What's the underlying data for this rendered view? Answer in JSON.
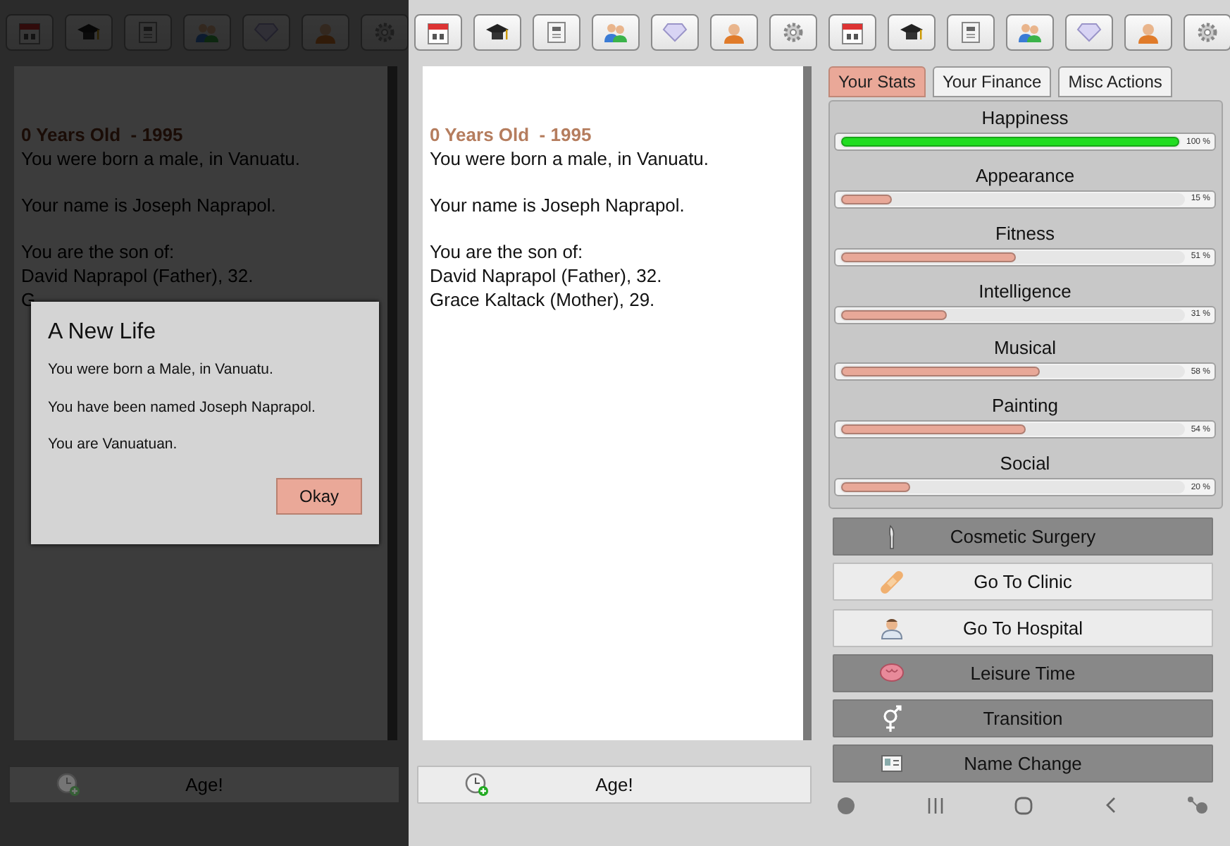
{
  "left_screen": {
    "dimmed": true,
    "story": {
      "heading": "0 Years Old  - 1995",
      "paragraphs": [
        [
          "You were born a male, in Vanuatu."
        ],
        [
          "Your name is Joseph Naprapol."
        ],
        [
          "You are the son of:",
          "David Naprapol (Father), 32.",
          "G"
        ]
      ]
    },
    "age_button": {
      "label": "Age!"
    },
    "dialog": {
      "title": "A New Life",
      "messages": [
        "You were born a Male, in Vanuatu.",
        "You have been named Joseph Naprapol.",
        "You are Vanuatuan."
      ],
      "button": "Okay"
    }
  },
  "right_screen": {
    "dimmed": false,
    "story": {
      "heading": "0 Years Old  - 1995",
      "paragraphs": [
        [
          "You were born a male, in Vanuatu."
        ],
        [
          "Your name is Joseph Naprapol."
        ],
        [
          "You are the son of:",
          "David Naprapol (Father), 32.",
          "Grace Kaltack (Mother), 29."
        ]
      ]
    },
    "age_button": {
      "label": "Age!"
    },
    "tabs": [
      {
        "label": "Your Stats",
        "selected": true
      },
      {
        "label": "Your Finance",
        "selected": false
      },
      {
        "label": "Misc Actions",
        "selected": false
      }
    ],
    "stats": [
      {
        "name": "Happiness",
        "level": 1.0,
        "reading": "100 %",
        "color": "#22dd22"
      },
      {
        "name": "Appearance",
        "level": 0.15,
        "reading": "15 %",
        "color": "#e8a898"
      },
      {
        "name": "Fitness",
        "level": 0.51,
        "reading": "51 %",
        "color": "#e8a898"
      },
      {
        "name": "Intelligence",
        "level": 0.31,
        "reading": "31 %",
        "color": "#e8a898"
      },
      {
        "name": "Musical",
        "level": 0.58,
        "reading": "58 %",
        "color": "#e8a898"
      },
      {
        "name": "Painting",
        "level": 0.54,
        "reading": "54 %",
        "color": "#e8a898"
      },
      {
        "name": "Social",
        "level": 0.2,
        "reading": "20 %",
        "color": "#e8a898"
      }
    ],
    "actions": [
      {
        "label": "Cosmetic Surgery",
        "disabled": true
      },
      {
        "label": "Go To Clinic",
        "disabled": false
      },
      {
        "label": "Go To Hospital",
        "disabled": false
      },
      {
        "label": "Leisure Time",
        "disabled": true
      },
      {
        "label": "Transition",
        "disabled": true
      },
      {
        "label": "Name Change",
        "disabled": true
      }
    ]
  }
}
